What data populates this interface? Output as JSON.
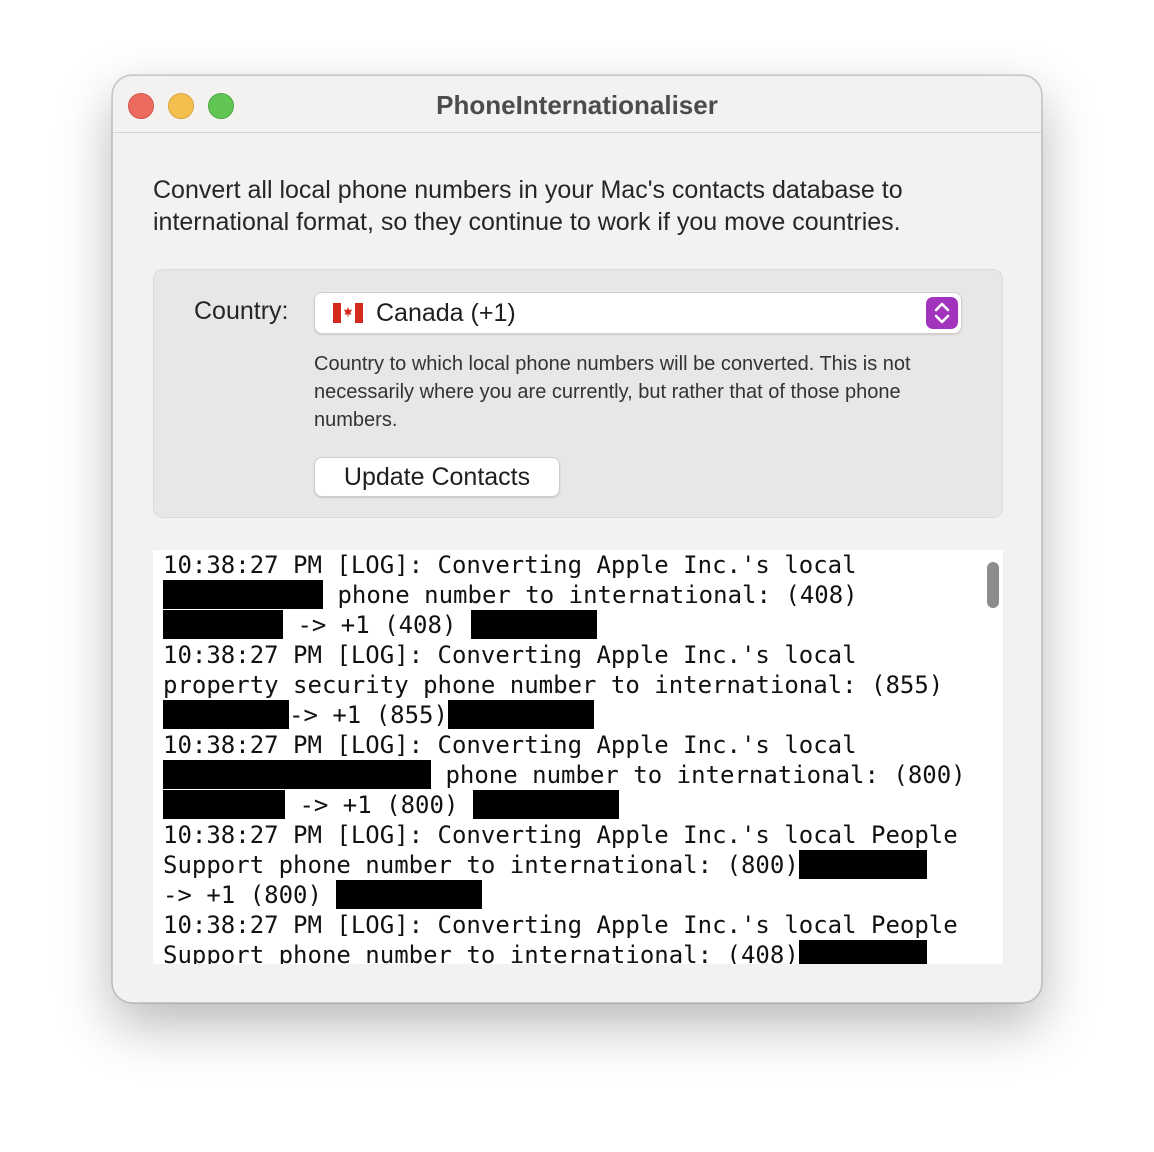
{
  "window": {
    "title": "PhoneInternationaliser"
  },
  "intro": "Convert all local phone numbers in your Mac's contacts database to international format, so they continue to work if you move countries.",
  "country": {
    "label": "Country:",
    "selected": "Canada (+1)",
    "flag_icon": "canada-flag-icon",
    "help": "Country to which local phone numbers will be converted. This is not necessarily where you are currently, but rather that of those phone numbers."
  },
  "update_button": "Update Contacts",
  "colors": {
    "accent": "#a233bd",
    "close": "#ed6a5e",
    "minimize": "#f5bf4f",
    "maximize": "#61c554"
  },
  "log": [
    "10:38:27 PM [LOG]: Converting Apple Inc.'s local",
    " phone number to international: (408)",
    "-> +1 (408)",
    "10:38:27 PM [LOG]: Converting Apple Inc.'s local",
    "property security phone number to international: (855)",
    "-> +1 (855)",
    "10:38:27 PM [LOG]: Converting Apple Inc.'s local",
    "phone number to international: (800)",
    "-> +1 (800)",
    "10:38:27 PM [LOG]: Converting Apple Inc.'s local People",
    "Support phone number to international: (800)",
    "-> +1 (800)",
    "10:38:27 PM [LOG]: Converting Apple Inc.'s local People",
    "Support phone number to international: (408)"
  ]
}
